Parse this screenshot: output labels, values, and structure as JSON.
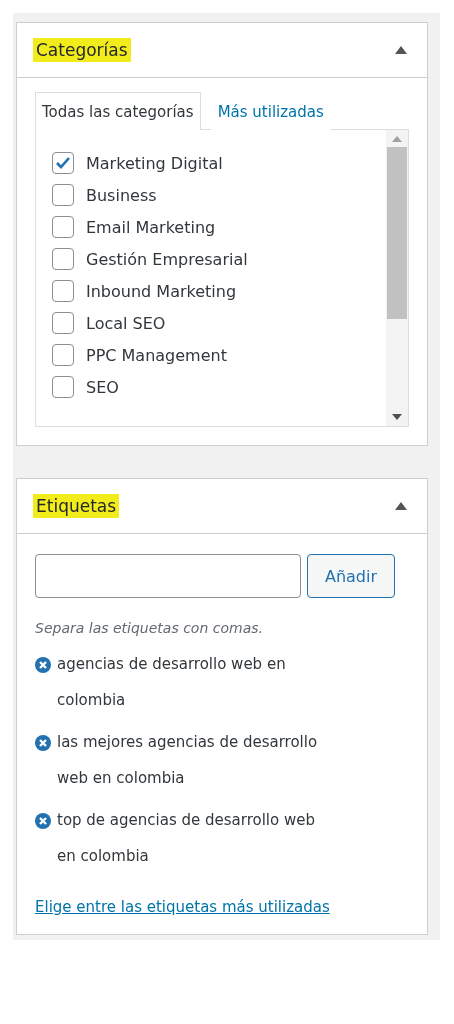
{
  "categories_box": {
    "title": "Categorías",
    "expanded": true,
    "tabs": [
      {
        "label": "Todas las categorías",
        "selected": true
      },
      {
        "label": "Más utilizadas",
        "selected": false
      }
    ],
    "items": [
      {
        "label": "Marketing Digital",
        "checked": true
      },
      {
        "label": "Business",
        "checked": false
      },
      {
        "label": "Email Marketing",
        "checked": false
      },
      {
        "label": "Gestión Empresarial",
        "checked": false
      },
      {
        "label": "Inbound Marketing",
        "checked": false
      },
      {
        "label": "Local SEO",
        "checked": false
      },
      {
        "label": "PPC Management",
        "checked": false
      },
      {
        "label": "SEO",
        "checked": false
      }
    ]
  },
  "tags_box": {
    "title": "Etiquetas",
    "expanded": true,
    "add_button": "Añadir",
    "hint": "Separa las etiquetas con comas.",
    "tags": [
      "agencias de desarrollo web en colombia",
      "las mejores agencias de desarrollo web en colombia",
      "top de agencias de desarrollo web en colombia"
    ],
    "link": "Elige entre las etiquetas más utilizadas"
  }
}
